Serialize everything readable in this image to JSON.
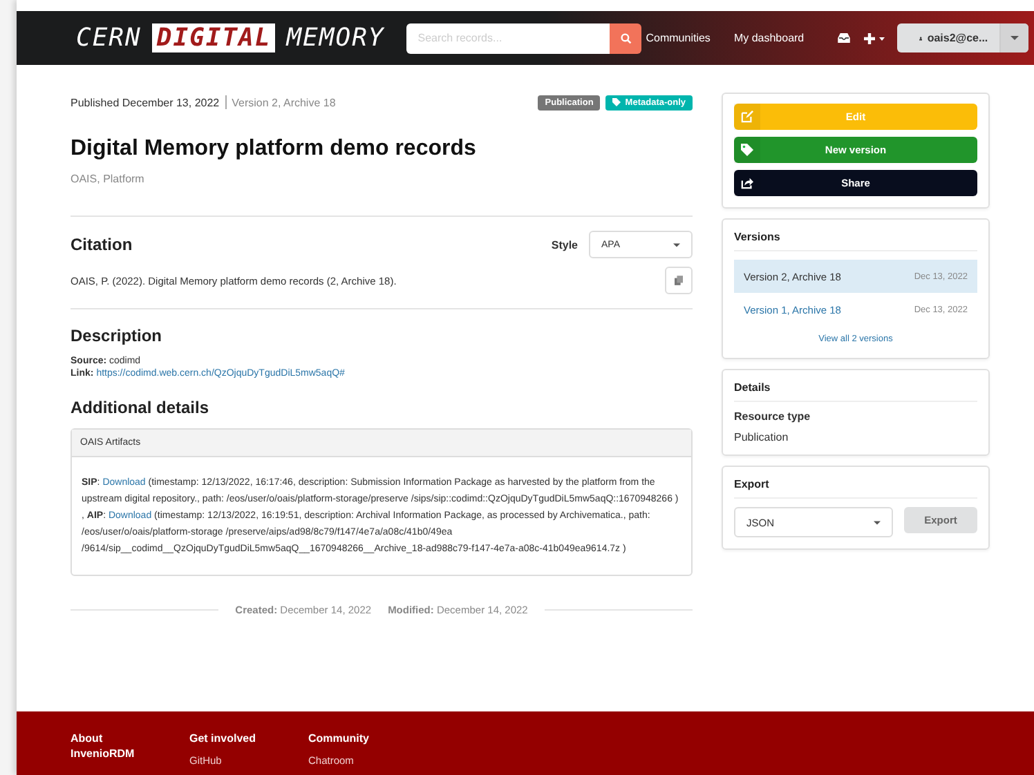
{
  "header": {
    "logo": {
      "prefix": "CERN",
      "highlight": "DIGITAL",
      "suffix": "MEMORY"
    },
    "search": {
      "placeholder": "Search records..."
    },
    "nav": [
      "Communities",
      "My dashboard"
    ],
    "user": "oais2@ce..."
  },
  "record": {
    "published": "Published December 13, 2022",
    "version": "Version 2, Archive 18",
    "badges": [
      {
        "kind": "plain",
        "text": "Publication"
      },
      {
        "kind": "tagged",
        "text": "Metadata-only"
      }
    ],
    "title": "Digital Memory platform demo records",
    "subjects": "OAIS, Platform",
    "citation": {
      "heading": "Citation",
      "style_label": "Style",
      "style": "APA",
      "text": "OAIS, P. (2022). Digital Memory platform demo records (2, Archive 18)."
    },
    "description": {
      "heading": "Description",
      "source": "**Source:** codimd",
      "link_label": "**Link:** ",
      "link": "https://codimd.web.cern.ch/QzOjquDyTgudDiL5mw5aqQ#"
    },
    "additional": {
      "heading": "Additional details",
      "panel_title": "OAIS Artifacts",
      "segments": [
        {
          "kind": "text",
          "text": "**SIP**: "
        },
        {
          "kind": "link",
          "text": "Download"
        },
        {
          "kind": "text",
          "text": " (timestamp: 12/13/2022, 16:17:46, description: Submission Information Package as harvested by the platform from the upstream digital repository., path: /eos/user/o/oais/platform-storage/preserve /sips/sip::codimd::QzOjquDyTgudDiL5mw5aqQ::1670948266 ) , **AIP**: "
        },
        {
          "kind": "link",
          "text": "Download"
        },
        {
          "kind": "text",
          "text": " (timestamp: 12/13/2022, 16:19:51, description: Archival Information Package, as processed by Archivematica., path: /eos/user/o/oais/platform-storage /preserve/aips/ad98/8c79/f147/4e7a/a08c/41b0/49ea /9614/sip__codimd__QzOjquDyTgudDiL5mw5aqQ__1670948266__Archive_18-ad988c79-f147-4e7a-a08c-41b049ea9614.7z )"
        }
      ]
    },
    "created": "**Created:** December 14, 2022",
    "modified": "**Modified:** December 14, 2022"
  },
  "sidebar": {
    "actions": [
      {
        "kind": "edit",
        "label": "Edit"
      },
      {
        "kind": "new-version",
        "label": "New version"
      },
      {
        "kind": "share",
        "label": "Share"
      }
    ],
    "versions": {
      "heading": "Versions",
      "items": [
        {
          "label": "Version 2, Archive 18",
          "date": "Dec 13, 2022",
          "selected": true
        },
        {
          "label": "Version 1, Archive 18",
          "date": "Dec 13, 2022",
          "selected": false
        }
      ],
      "view_all": "View all 2 versions"
    },
    "details": {
      "heading": "Details",
      "label": "Resource type",
      "value": "Publication"
    },
    "export": {
      "heading": "Export",
      "format": "JSON",
      "button": "Export"
    }
  },
  "footer": {
    "columns": [
      {
        "heading": "About InvenioRDM"
      },
      {
        "heading": "Get involved",
        "links": [
          "GitHub"
        ]
      },
      {
        "heading": "Community",
        "links": [
          "Chatroom"
        ]
      }
    ]
  }
}
